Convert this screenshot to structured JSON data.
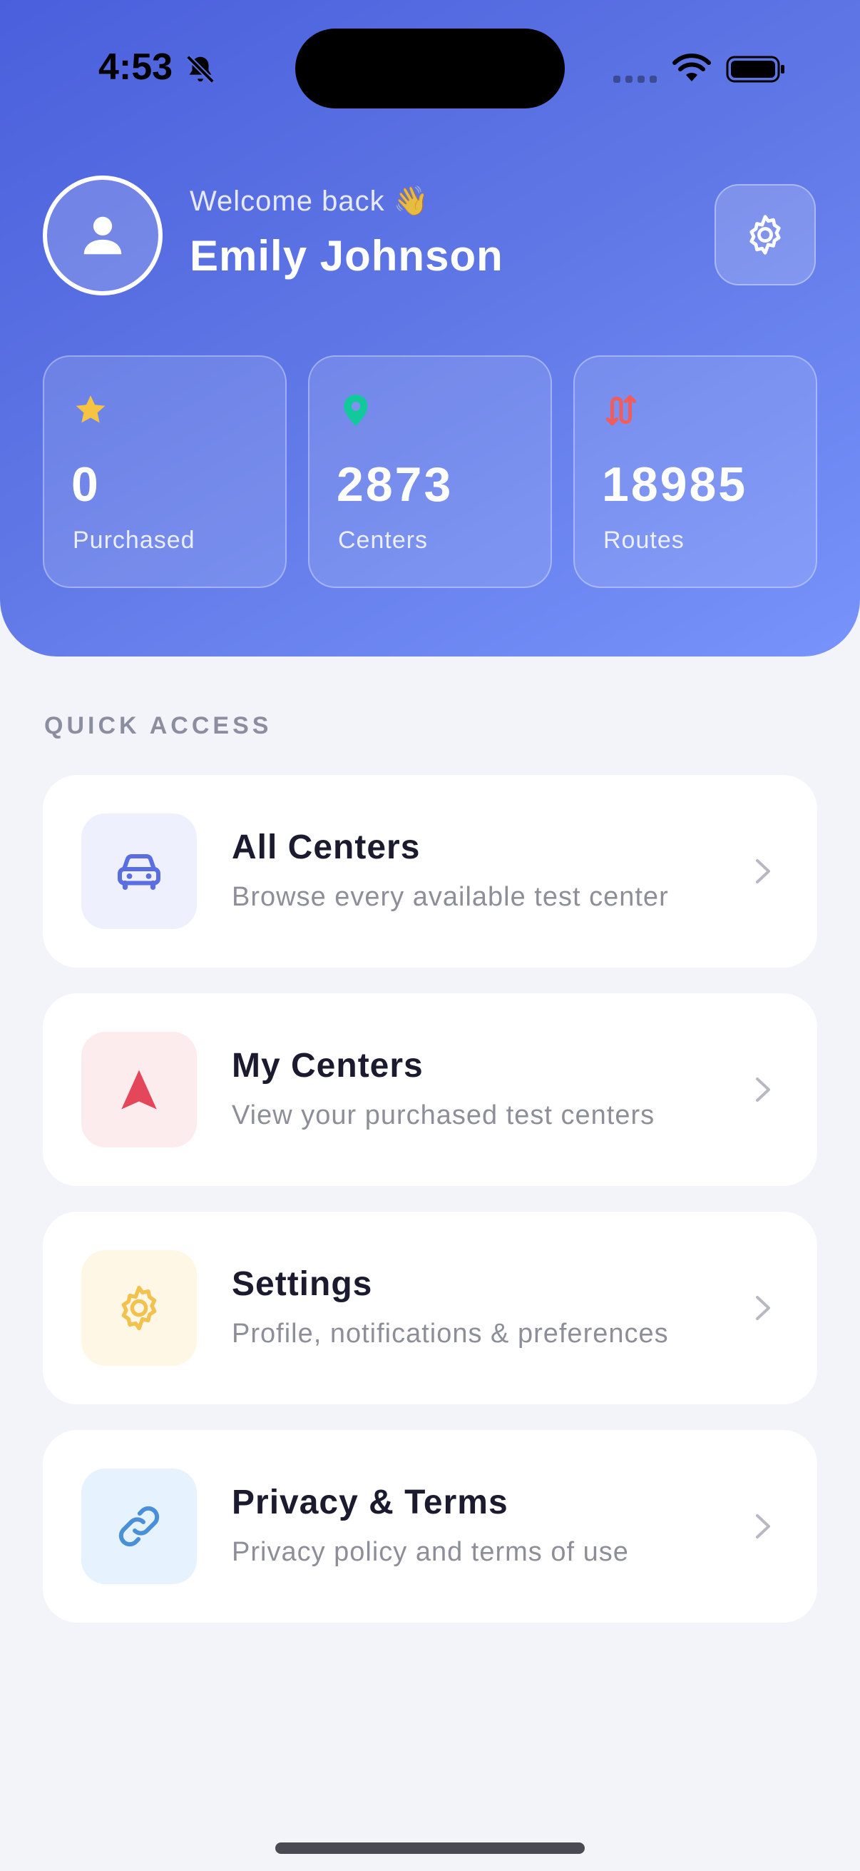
{
  "status_bar": {
    "time": "4:53",
    "icons": [
      "bell-off-icon",
      "cellular-signal-icon",
      "wifi-icon",
      "battery-icon"
    ]
  },
  "header": {
    "welcome": "Welcome back 👋",
    "user_name": "Emily Johnson",
    "avatar_icon": "person-icon",
    "settings_icon": "gear-icon"
  },
  "stats": [
    {
      "icon": "star-icon",
      "icon_color": "#f6c343",
      "value": "0",
      "label": "Purchased"
    },
    {
      "icon": "location-pin-icon",
      "icon_color": "#12c99b",
      "value": "2873",
      "label": "Centers"
    },
    {
      "icon": "route-icon",
      "icon_color": "#ef5d5d",
      "value": "18985",
      "label": "Routes"
    }
  ],
  "quick_access": {
    "title": "QUICK ACCESS",
    "items": [
      {
        "title": "All Centers",
        "subtitle": "Browse every available test center",
        "icon": "car-icon",
        "icon_color": "#5b6ee1",
        "icon_bg": "#eef0fd"
      },
      {
        "title": "My Centers",
        "subtitle": "View your purchased test centers",
        "icon": "navigation-arrow-icon",
        "icon_color": "#e5475a",
        "icon_bg": "#fdecee"
      },
      {
        "title": "Settings",
        "subtitle": "Profile, notifications & preferences",
        "icon": "gear-icon",
        "icon_color": "#f2c14e",
        "icon_bg": "#fff7e6"
      },
      {
        "title": "Privacy & Terms",
        "subtitle": "Privacy policy and terms of use",
        "icon": "link-icon",
        "icon_color": "#4a90d9",
        "icon_bg": "#e6f2fd"
      }
    ]
  },
  "colors": {
    "hero_gradient_start": "#4a5fdc",
    "hero_gradient_end": "#7893fb",
    "page_background": "#f3f3fa"
  }
}
